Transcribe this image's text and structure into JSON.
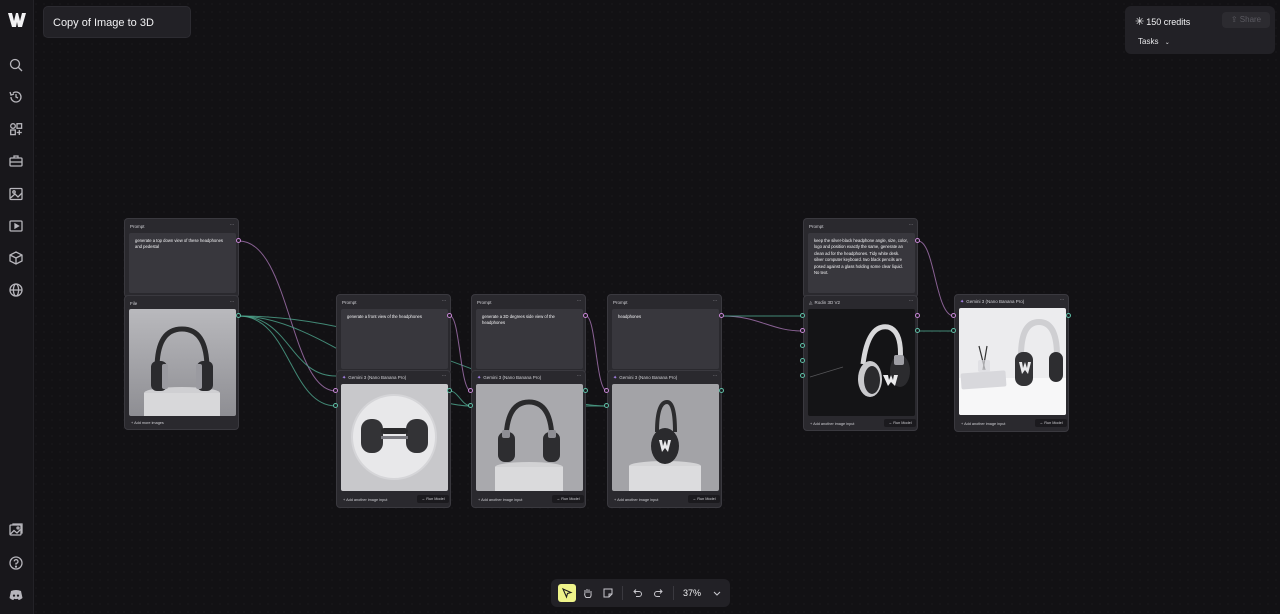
{
  "app": {
    "project_title": "Copy of Image to 3D"
  },
  "topbar": {
    "credits": "150 credits",
    "share_label": "Share",
    "tasks_label": "Tasks"
  },
  "sidebar": {
    "items": [
      "logo-icon",
      "search-icon",
      "history-icon",
      "apps-icon",
      "toolbox-icon",
      "image-icon",
      "video-icon",
      "3d-cube-icon",
      "globe-icon",
      "image-gallery-icon",
      "help-icon",
      "discord-icon"
    ]
  },
  "nodes": {
    "prompt1": {
      "header": "Prompt",
      "text": "generate a top down view of these headphones and pedestal"
    },
    "file1": {
      "header": "File",
      "footer": "+ Add more images"
    },
    "prompt2": {
      "header": "Prompt",
      "text": "generate a front view of the headphones"
    },
    "prompt3": {
      "header": "Prompt",
      "text": "generate a 3D degrees side view of the headphones"
    },
    "prompt4": {
      "header": "Prompt",
      "text": "headphones"
    },
    "gemini2": {
      "header": "Gemini 3 (Nano Banana Pro)",
      "footer": "+ Add another image input",
      "run": "Run Model"
    },
    "gemini3": {
      "header": "Gemini 3 (Nano Banana Pro)",
      "footer": "+ Add another image input",
      "run": "Run Model"
    },
    "gemini4": {
      "header": "Gemini 3 (Nano Banana Pro)",
      "footer": "+ Add another image input",
      "run": "Run Model"
    },
    "prompt5": {
      "header": "Prompt",
      "text": "keep the silver-black headphone angle, size, color, logo and position exactly the same, generate an clean ad for the headphones. Tidy white desk. silver computer keyboard. two black pencils are posed against a glass holding some clear liquid. No text."
    },
    "rodin": {
      "header": "Rodin 3D V2",
      "footer": "+ Add another image input",
      "run": "Run Model"
    },
    "gemini5": {
      "header": "Gemini 3 (Nano Banana Pro)",
      "footer": "+ Add another image input",
      "run": "Run Model"
    }
  },
  "toolbar": {
    "zoom": "37%"
  },
  "colors": {
    "prompt_port": "#c887d6",
    "image_port": "#5fbfa6",
    "active_tool": "#eef38a",
    "model_icon": "#b58dff"
  }
}
